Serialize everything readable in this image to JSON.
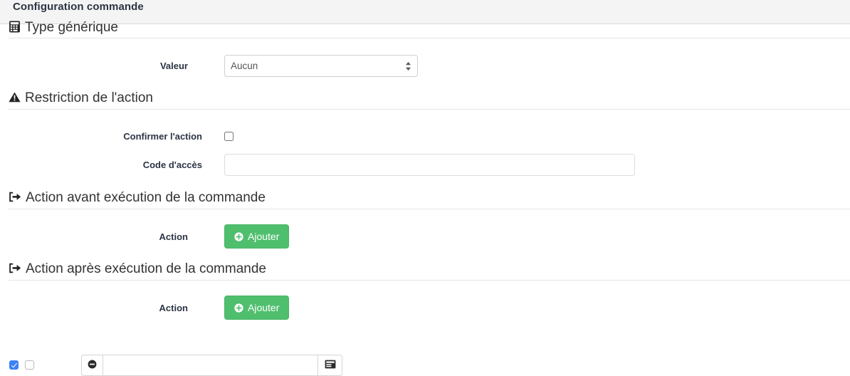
{
  "panel": {
    "title": "Configuration commande"
  },
  "sections": {
    "generic_type": {
      "title": "Type générique",
      "icon": "calculator-icon",
      "value_label": "Valeur",
      "select_value": "Aucun",
      "select_options": [
        "Aucun"
      ]
    },
    "restriction": {
      "title": "Restriction de l'action",
      "icon": "warning-triangle-icon",
      "confirm_label": "Confirmer l'action",
      "confirm_checked": false,
      "access_code_label": "Code d'accès",
      "access_code_value": "",
      "access_code_placeholder": ""
    },
    "action_before": {
      "title": "Action avant exécution de la commande",
      "icon": "sign-out-icon",
      "action_label": "Action",
      "add_button_label": "Ajouter"
    },
    "action_after": {
      "title": "Action après exécution de la commande",
      "icon": "sign-out-icon",
      "action_label": "Action",
      "add_button_label": "Ajouter",
      "row": {
        "check_one_checked": true,
        "check_two_checked": false,
        "remove_icon": "minus-circle-icon",
        "expression_value": "",
        "expression_placeholder": "",
        "picker_icon": "window-list-icon"
      }
    }
  },
  "colors": {
    "header_bg": "#f4f4f4",
    "success_green": "#4fbf6e",
    "checkbox_blue": "#3c82f6",
    "text_dark": "#2b3444",
    "rule": "#e5e5e5"
  }
}
